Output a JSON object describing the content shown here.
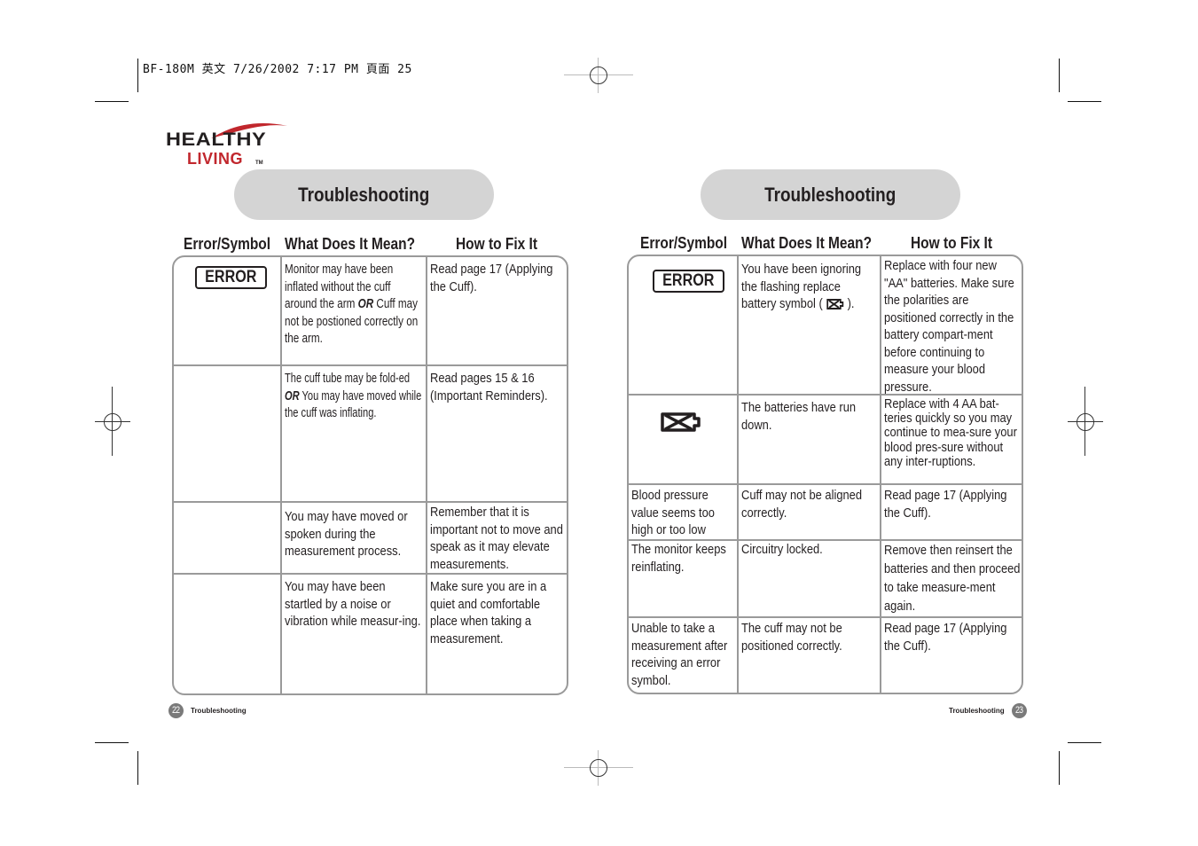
{
  "slug": {
    "text": "BF-180M 英文  7/26/2002  7:17 PM  頁面 25"
  },
  "logo": {
    "line1": "HEALTHY",
    "line2": "LIVING",
    "trademark": "TM",
    "brand_red": "#c1272d",
    "brand_dark": "#231f20"
  },
  "colors": {
    "pill_bg": "#d4d4d4",
    "table_border": "#9a9a9a",
    "page_number_bg": "#7a7a7a"
  },
  "left_page": {
    "title": "Troubleshooting",
    "headers": [
      "Error/Symbol",
      "What Does It Mean?",
      "How to Fix It"
    ],
    "rows": [
      {
        "symbol": "ERROR",
        "meaning": "Monitor may have been inflated without the cuff around the arm OR Cuff may not be postioned correctly on the arm.",
        "meaning_parts": [
          "Monitor may have been inflated without the cuff around the arm ",
          "OR",
          " Cuff may not be postioned correctly on the arm."
        ],
        "fix": "Read page 17 (Applying the Cuff)."
      },
      {
        "symbol": "",
        "meaning": "The cuff  tube may be folded OR You may have moved while the cuff was inflating.",
        "meaning_parts": [
          "The cuff  tube may be fold-ed ",
          "OR",
          " You may have moved while the cuff was inflating."
        ],
        "fix": "Read pages 15 & 16 (Important Reminders)."
      },
      {
        "symbol": "",
        "meaning": "You may have moved or spoken during the measurement process.",
        "fix": "Remember that it is important not to move and speak as it may elevate measurements."
      },
      {
        "symbol": "",
        "meaning": "You may have been startled by a noise or vibration while measur-ing.",
        "fix": "Make sure you are in a quiet and comfortable place when taking a measurement."
      }
    ],
    "footer": {
      "page_number": "22",
      "section": "Troubleshooting"
    }
  },
  "right_page": {
    "title": "Troubleshooting",
    "headers": [
      "Error/Symbol",
      "What Does It Mean?",
      "How to Fix It"
    ],
    "rows": [
      {
        "symbol": "ERROR",
        "meaning_before": "You have been ignoring the flashing replace battery symbol ( ",
        "meaning_after": " ).",
        "meaning_icon": "battery-empty-icon",
        "fix": "Replace with four new \"AA\" batteries. Make sure the polarities are positioned correctly in the battery compart-ment before continuing to measure your blood pressure."
      },
      {
        "symbol_icon": "battery-empty-icon",
        "meaning": "The batteries have run down.",
        "fix": "Replace with 4 AA bat-teries quickly so you may continue to mea-sure your blood pres-sure without any inter-ruptions."
      },
      {
        "symbol": "Blood pressure value seems too high or too low",
        "meaning": "Cuff may not be aligned correctly.",
        "fix": "Read page 17 (Applying the Cuff)."
      },
      {
        "symbol": "The monitor keeps reinflating.",
        "meaning": "Circuitry locked.",
        "fix": "Remove then reinsert the batteries and then proceed to take measure-ment again."
      },
      {
        "symbol": "Unable to take a measurement after receiving an error symbol.",
        "meaning": "The cuff may not be positioned correctly.",
        "fix": "Read page 17 (Applying the Cuff)."
      }
    ],
    "footer": {
      "page_number": "23",
      "section": "Troubleshooting"
    }
  }
}
